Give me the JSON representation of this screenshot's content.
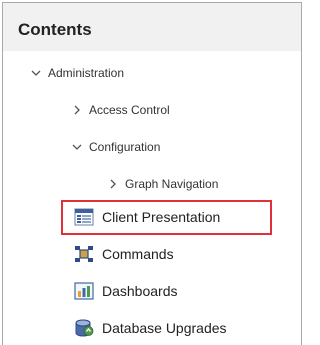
{
  "panel": {
    "title": "Contents"
  },
  "tree": {
    "administration": "Administration",
    "access_control": "Access Control",
    "configuration": "Configuration",
    "graph_navigation": "Graph Navigation"
  },
  "items": {
    "client_presentation": "Client Presentation",
    "commands": "Commands",
    "dashboards": "Dashboards",
    "database_upgrades": "Database Upgrades"
  },
  "highlight": {
    "target": "Client Presentation",
    "color": "#e0303a"
  }
}
